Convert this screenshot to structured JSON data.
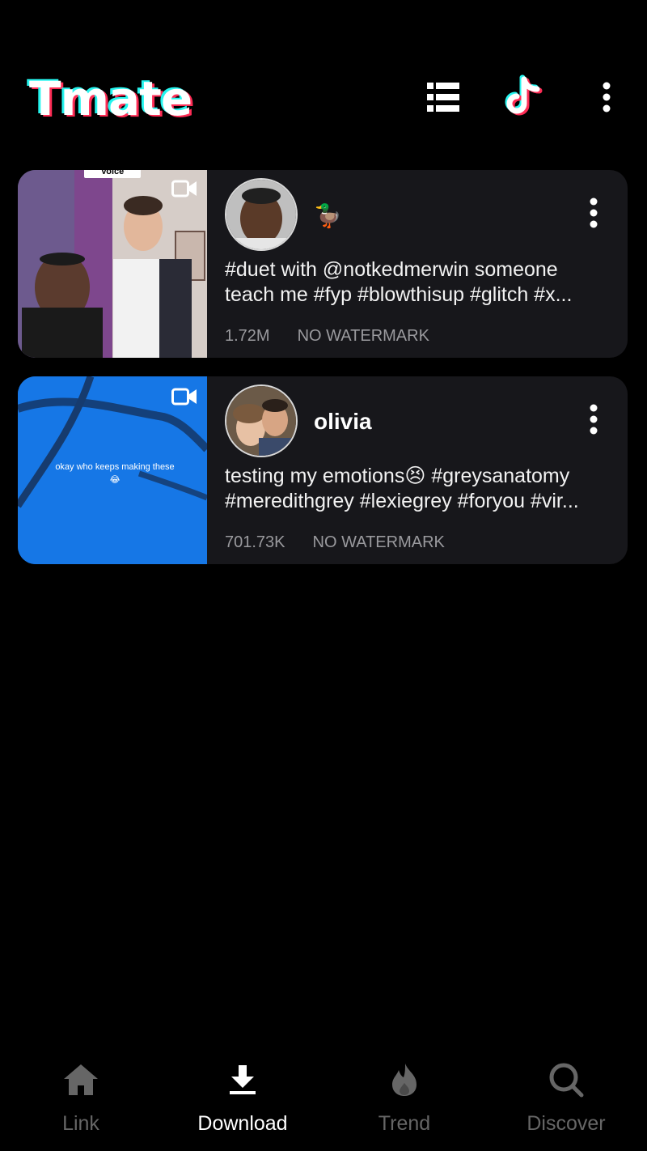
{
  "app": {
    "logo_text": "Tmate"
  },
  "header": {
    "icons": [
      "list-icon",
      "tiktok-icon",
      "more-vertical-icon"
    ],
    "colors": {
      "cyan": "#25f4ee",
      "pink": "#fe2c55"
    }
  },
  "videos": [
    {
      "name": "🦆",
      "caption_line1": "#duet with @notkedmerwin someone",
      "caption_line2": "teach me #fyp #blowthisup #glitch #x...",
      "views": "1.72M",
      "watermark": "NO WATERMARK",
      "thumb_overlay_top": "Voice"
    },
    {
      "name": "olivia",
      "caption_line1": "testing my emotions😣 #greysanatomy",
      "caption_line2": "#meredithgrey #lexiegrey #foryou #vir...",
      "views": "701.73K",
      "watermark": "NO WATERMARK",
      "thumb_text": "okay who keeps making these 😂"
    }
  ],
  "nav": {
    "items": [
      {
        "label": "Link",
        "icon": "home-icon"
      },
      {
        "label": "Download",
        "icon": "download-icon"
      },
      {
        "label": "Trend",
        "icon": "fire-icon"
      },
      {
        "label": "Discover",
        "icon": "search-icon"
      }
    ],
    "active": "Download"
  }
}
